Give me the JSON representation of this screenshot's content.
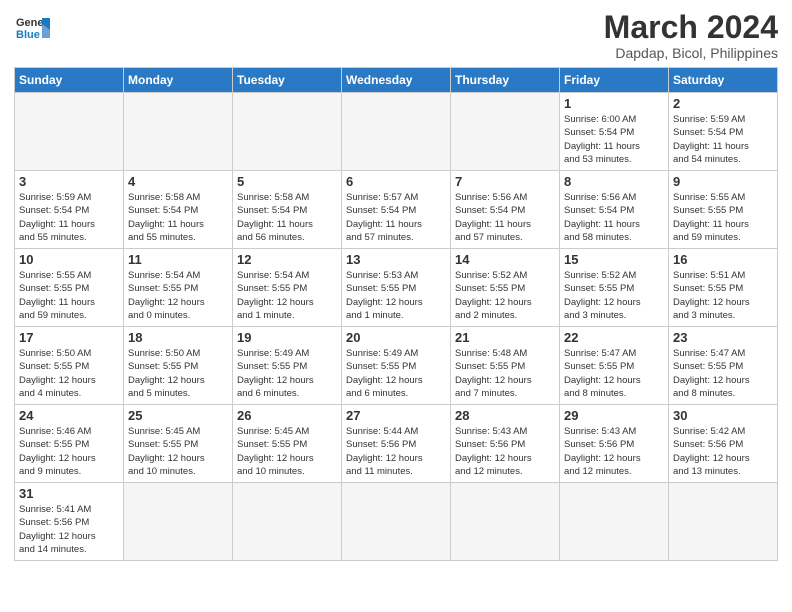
{
  "header": {
    "logo_general": "General",
    "logo_blue": "Blue",
    "month_title": "March 2024",
    "location": "Dapdap, Bicol, Philippines"
  },
  "weekdays": [
    "Sunday",
    "Monday",
    "Tuesday",
    "Wednesday",
    "Thursday",
    "Friday",
    "Saturday"
  ],
  "weeks": [
    [
      {
        "day": "",
        "info": ""
      },
      {
        "day": "",
        "info": ""
      },
      {
        "day": "",
        "info": ""
      },
      {
        "day": "",
        "info": ""
      },
      {
        "day": "",
        "info": ""
      },
      {
        "day": "1",
        "info": "Sunrise: 6:00 AM\nSunset: 5:54 PM\nDaylight: 11 hours\nand 53 minutes."
      },
      {
        "day": "2",
        "info": "Sunrise: 5:59 AM\nSunset: 5:54 PM\nDaylight: 11 hours\nand 54 minutes."
      }
    ],
    [
      {
        "day": "3",
        "info": "Sunrise: 5:59 AM\nSunset: 5:54 PM\nDaylight: 11 hours\nand 55 minutes."
      },
      {
        "day": "4",
        "info": "Sunrise: 5:58 AM\nSunset: 5:54 PM\nDaylight: 11 hours\nand 55 minutes."
      },
      {
        "day": "5",
        "info": "Sunrise: 5:58 AM\nSunset: 5:54 PM\nDaylight: 11 hours\nand 56 minutes."
      },
      {
        "day": "6",
        "info": "Sunrise: 5:57 AM\nSunset: 5:54 PM\nDaylight: 11 hours\nand 57 minutes."
      },
      {
        "day": "7",
        "info": "Sunrise: 5:56 AM\nSunset: 5:54 PM\nDaylight: 11 hours\nand 57 minutes."
      },
      {
        "day": "8",
        "info": "Sunrise: 5:56 AM\nSunset: 5:54 PM\nDaylight: 11 hours\nand 58 minutes."
      },
      {
        "day": "9",
        "info": "Sunrise: 5:55 AM\nSunset: 5:55 PM\nDaylight: 11 hours\nand 59 minutes."
      }
    ],
    [
      {
        "day": "10",
        "info": "Sunrise: 5:55 AM\nSunset: 5:55 PM\nDaylight: 11 hours\nand 59 minutes."
      },
      {
        "day": "11",
        "info": "Sunrise: 5:54 AM\nSunset: 5:55 PM\nDaylight: 12 hours\nand 0 minutes."
      },
      {
        "day": "12",
        "info": "Sunrise: 5:54 AM\nSunset: 5:55 PM\nDaylight: 12 hours\nand 1 minute."
      },
      {
        "day": "13",
        "info": "Sunrise: 5:53 AM\nSunset: 5:55 PM\nDaylight: 12 hours\nand 1 minute."
      },
      {
        "day": "14",
        "info": "Sunrise: 5:52 AM\nSunset: 5:55 PM\nDaylight: 12 hours\nand 2 minutes."
      },
      {
        "day": "15",
        "info": "Sunrise: 5:52 AM\nSunset: 5:55 PM\nDaylight: 12 hours\nand 3 minutes."
      },
      {
        "day": "16",
        "info": "Sunrise: 5:51 AM\nSunset: 5:55 PM\nDaylight: 12 hours\nand 3 minutes."
      }
    ],
    [
      {
        "day": "17",
        "info": "Sunrise: 5:50 AM\nSunset: 5:55 PM\nDaylight: 12 hours\nand 4 minutes."
      },
      {
        "day": "18",
        "info": "Sunrise: 5:50 AM\nSunset: 5:55 PM\nDaylight: 12 hours\nand 5 minutes."
      },
      {
        "day": "19",
        "info": "Sunrise: 5:49 AM\nSunset: 5:55 PM\nDaylight: 12 hours\nand 6 minutes."
      },
      {
        "day": "20",
        "info": "Sunrise: 5:49 AM\nSunset: 5:55 PM\nDaylight: 12 hours\nand 6 minutes."
      },
      {
        "day": "21",
        "info": "Sunrise: 5:48 AM\nSunset: 5:55 PM\nDaylight: 12 hours\nand 7 minutes."
      },
      {
        "day": "22",
        "info": "Sunrise: 5:47 AM\nSunset: 5:55 PM\nDaylight: 12 hours\nand 8 minutes."
      },
      {
        "day": "23",
        "info": "Sunrise: 5:47 AM\nSunset: 5:55 PM\nDaylight: 12 hours\nand 8 minutes."
      }
    ],
    [
      {
        "day": "24",
        "info": "Sunrise: 5:46 AM\nSunset: 5:55 PM\nDaylight: 12 hours\nand 9 minutes."
      },
      {
        "day": "25",
        "info": "Sunrise: 5:45 AM\nSunset: 5:55 PM\nDaylight: 12 hours\nand 10 minutes."
      },
      {
        "day": "26",
        "info": "Sunrise: 5:45 AM\nSunset: 5:55 PM\nDaylight: 12 hours\nand 10 minutes."
      },
      {
        "day": "27",
        "info": "Sunrise: 5:44 AM\nSunset: 5:56 PM\nDaylight: 12 hours\nand 11 minutes."
      },
      {
        "day": "28",
        "info": "Sunrise: 5:43 AM\nSunset: 5:56 PM\nDaylight: 12 hours\nand 12 minutes."
      },
      {
        "day": "29",
        "info": "Sunrise: 5:43 AM\nSunset: 5:56 PM\nDaylight: 12 hours\nand 12 minutes."
      },
      {
        "day": "30",
        "info": "Sunrise: 5:42 AM\nSunset: 5:56 PM\nDaylight: 12 hours\nand 13 minutes."
      }
    ],
    [
      {
        "day": "31",
        "info": "Sunrise: 5:41 AM\nSunset: 5:56 PM\nDaylight: 12 hours\nand 14 minutes."
      },
      {
        "day": "",
        "info": ""
      },
      {
        "day": "",
        "info": ""
      },
      {
        "day": "",
        "info": ""
      },
      {
        "day": "",
        "info": ""
      },
      {
        "day": "",
        "info": ""
      },
      {
        "day": "",
        "info": ""
      }
    ]
  ]
}
